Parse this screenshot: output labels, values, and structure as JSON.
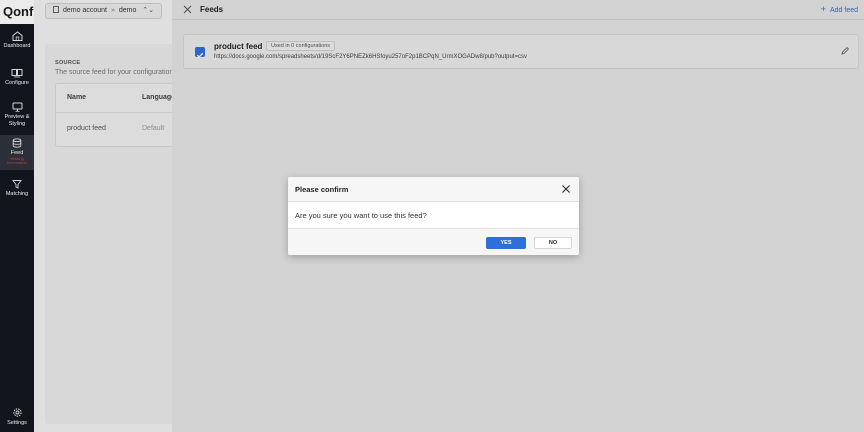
{
  "sidebar": {
    "logo": "Qonfi",
    "items": [
      {
        "label": "Dashboard",
        "icon": "home-icon"
      },
      {
        "label": "Configure",
        "icon": "configure-icon"
      },
      {
        "label": "Preview & Styling",
        "icon": "monitor-icon"
      },
      {
        "label": "Feed",
        "sublabel": "Missing information",
        "icon": "database-icon",
        "active": true
      },
      {
        "label": "Matching",
        "icon": "funnel-icon"
      }
    ],
    "settings": {
      "label": "Settings",
      "icon": "gear-icon"
    }
  },
  "topbar": {
    "account": "demo account",
    "separator": "»",
    "project": "demo",
    "chevron": "⌃⌄"
  },
  "source_section": {
    "title": "SOURCE",
    "description": "The source feed for your configuration",
    "columns": [
      "Name",
      "Language"
    ],
    "rows": [
      {
        "name": "product feed",
        "language": "Default"
      }
    ]
  },
  "drawer": {
    "title": "Feeds",
    "add_label": "Add feed",
    "feed": {
      "name": "product feed",
      "badge": "Used in 0 configurations",
      "url": "https://docs.google.com/spreadsheets/d/19ScF2Y6PNEZk6HSfoyu257oF2p1BCPqN_UrmXOGADw8/pub?output=csv",
      "checked": true
    }
  },
  "modal": {
    "title": "Please confirm",
    "message": "Are you sure you want to use this feed?",
    "yes_label": "YES",
    "no_label": "NO"
  },
  "colors": {
    "accent": "#2f6fdc",
    "sidebar_bg": "#14181f",
    "warning": "#e23b3b"
  }
}
